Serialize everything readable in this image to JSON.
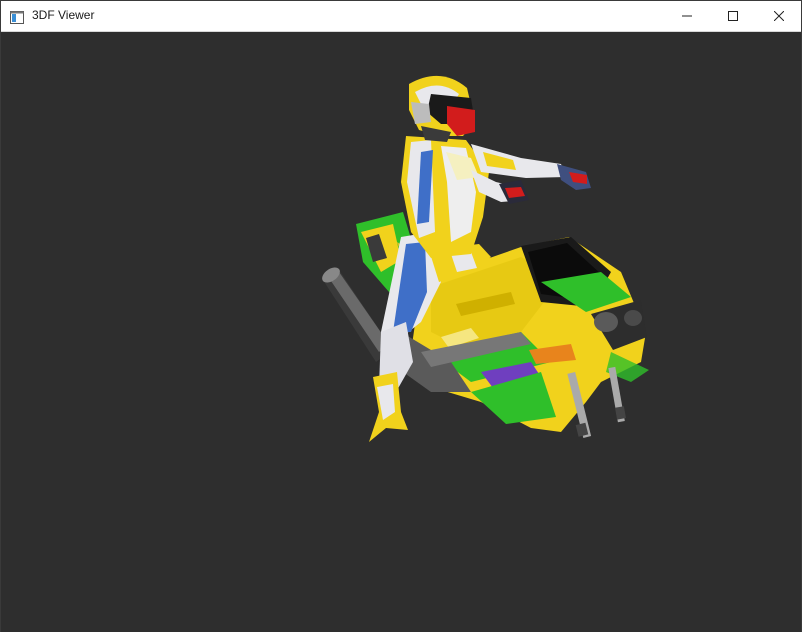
{
  "window": {
    "title": "3DF Viewer",
    "controls": {
      "minimize": "minimize-icon",
      "maximize": "maximize-icon",
      "close": "close-icon"
    }
  },
  "viewport": {
    "background": "#2e2e2e",
    "model_colors": {
      "yellow": "#f1d21c",
      "green": "#2fbf2a",
      "blue": "#3f6fc8",
      "red": "#d21c1c"
    }
  }
}
